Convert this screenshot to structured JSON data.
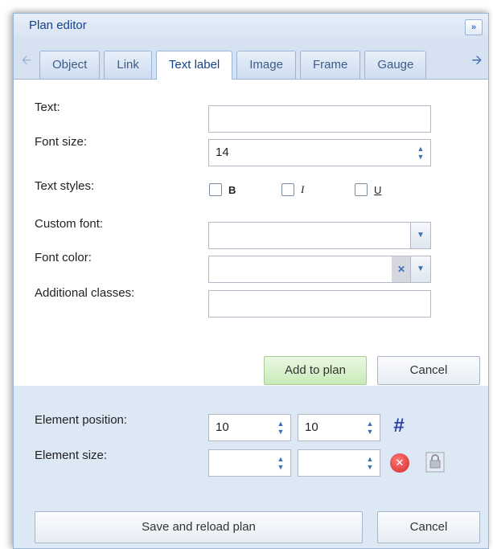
{
  "panel": {
    "title": "Plan editor",
    "collapse_glyph": "»"
  },
  "tabs": [
    {
      "label": "Object",
      "active": false
    },
    {
      "label": "Link",
      "active": false
    },
    {
      "label": "Text label",
      "active": true
    },
    {
      "label": "Image",
      "active": false
    },
    {
      "label": "Frame",
      "active": false
    },
    {
      "label": "Gauge",
      "active": false
    }
  ],
  "form": {
    "text_label": "Text:",
    "text_value": "",
    "font_size_label": "Font size:",
    "font_size_value": "14",
    "text_styles_label": "Text styles:",
    "bold_label": "B",
    "italic_label": "I",
    "underline_label": "U",
    "custom_font_label": "Custom font:",
    "custom_font_value": "",
    "font_color_label": "Font color:",
    "font_color_value": "",
    "additional_classes_label": "Additional classes:",
    "additional_classes_value": "",
    "add_button": "Add to plan",
    "cancel_button": "Cancel"
  },
  "position": {
    "position_label": "Element position:",
    "pos_x": "10",
    "pos_y": "10",
    "size_label": "Element size:",
    "width": "",
    "height": ""
  },
  "footer": {
    "save_button": "Save and reload plan",
    "cancel_button": "Cancel"
  },
  "icons": {
    "scroll_left": "arrow-left-icon",
    "scroll_right": "arrow-right-icon",
    "grid": "grid-icon",
    "remove": "remove-icon",
    "lock": "lock-icon"
  },
  "colors": {
    "title": "#15428b",
    "panel_bg": "#dde8f5",
    "add_button_bg": "#c8ebb8",
    "remove_icon": "#d12727",
    "grid_icon": "#2c3fa8"
  }
}
